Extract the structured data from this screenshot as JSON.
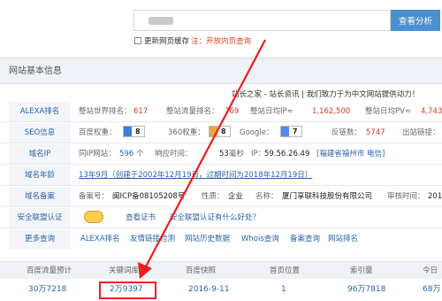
{
  "search": {
    "query": "",
    "button_label": "查看分析"
  },
  "cache": {
    "label": "更新网页缓存",
    "hint": "注：开放内页查询"
  },
  "panel": {
    "title": "网站基本信息"
  },
  "slogan": "站长之家 - 站长资讯 | 我们致力于为中文网站提供动力！",
  "alexa": {
    "label": "ALEXA排名",
    "world_rank_label": "整站世界排名：",
    "world_rank": "617",
    "traffic_rank_label": "整站流量排名：",
    "traffic_rank": "769",
    "daily_ip_label": "整站日均IP≈",
    "daily_ip": "1,162,500",
    "daily_pv_label": "整站日均PV≈",
    "daily_pv": "4,743,"
  },
  "seo": {
    "label": "SEO信息",
    "baidu_label": "百度权重：",
    "baidu": "8",
    "s360_label": "360权重：",
    "s360": "8",
    "google_label": "Google：",
    "google": "7",
    "backlinks_label": "反链数：",
    "backlinks": "5747",
    "outlinks_label": "出站链接："
  },
  "ip": {
    "label": "域名IP",
    "same_ip_label": "同IP网站：",
    "same_ip": "596",
    "same_ip_unit": "个",
    "response_label": "响应时间：",
    "response": "53",
    "response_unit": "毫秒",
    "ip_label": "IP：",
    "ip": "59.56.26.49",
    "location": "[福建省福州市 电信]"
  },
  "age": {
    "label": "域名年龄",
    "text": "13年9月（创建于2002年12月19日，过期时间为2018年12月19日）"
  },
  "icp": {
    "label": "域名备案",
    "no_label": "备案号：",
    "no": "闽ICP备08105208号",
    "nature_label": "性质：",
    "nature": "企业",
    "name_label": "名称：",
    "name": "厦门享联科技股份有限公司",
    "time_label": "审核时间：",
    "time": "201"
  },
  "security": {
    "label": "安全联盟认证",
    "view_cert": "查看证书",
    "question": "安全联盟认证有什么好处？"
  },
  "more": {
    "label": "更多查询",
    "links": [
      "ALEXA排名",
      "友情链接检测",
      "网站历史数据",
      "Whois查询",
      "备案查询",
      "网站排名"
    ]
  },
  "table": {
    "headers": [
      "百度流量预计",
      "关键词库",
      "百度快照",
      "首页位置",
      "索引量",
      "今日"
    ],
    "row": [
      "30万7218",
      "2万9397",
      "2016-9-11",
      "1",
      "96万7818",
      "68万"
    ]
  },
  "colors": {
    "accent": "#4a8fd0",
    "highlight": "#ee1c1c",
    "link": "#2c63a8"
  }
}
